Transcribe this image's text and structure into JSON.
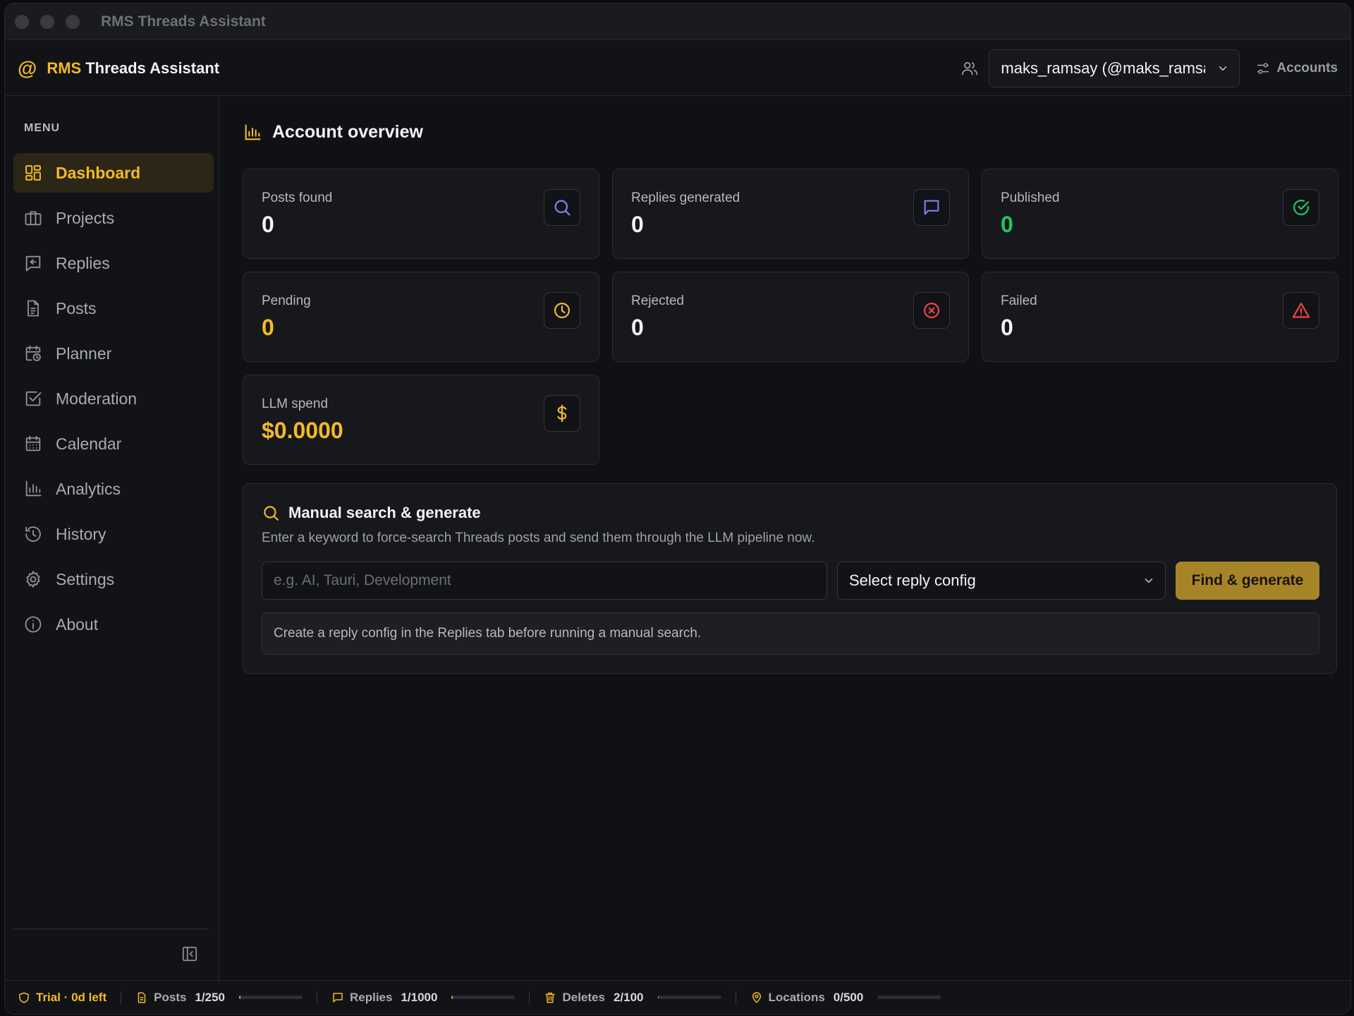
{
  "window": {
    "title": "RMS Threads Assistant"
  },
  "brand": {
    "prefix": "RMS",
    "name": "Threads Assistant"
  },
  "header": {
    "account_value": "maks_ramsay (@maks_ramsay)",
    "accounts_label": "Accounts"
  },
  "sidebar": {
    "menu_label": "MENU",
    "items": [
      {
        "label": "Dashboard",
        "icon": "dashboard-icon",
        "active": true
      },
      {
        "label": "Projects",
        "icon": "briefcase-icon"
      },
      {
        "label": "Replies",
        "icon": "reply-icon"
      },
      {
        "label": "Posts",
        "icon": "document-icon"
      },
      {
        "label": "Planner",
        "icon": "calendar-clock-icon"
      },
      {
        "label": "Moderation",
        "icon": "checkbox-icon"
      },
      {
        "label": "Calendar",
        "icon": "calendar-icon"
      },
      {
        "label": "Analytics",
        "icon": "bar-chart-icon"
      },
      {
        "label": "History",
        "icon": "history-icon"
      },
      {
        "label": "Settings",
        "icon": "gear-icon"
      },
      {
        "label": "About",
        "icon": "info-icon"
      }
    ]
  },
  "overview": {
    "title": "Account overview",
    "cards": [
      {
        "label": "Posts found",
        "value": "0",
        "color": "#f2f3f5",
        "icon": "search-icon"
      },
      {
        "label": "Replies generated",
        "value": "0",
        "color": "#f2f3f5",
        "icon": "message-icon"
      },
      {
        "label": "Published",
        "value": "0",
        "color": "#22c55e",
        "icon": "check-circle-icon"
      },
      {
        "label": "Pending",
        "value": "0",
        "color": "#f4b928",
        "icon": "clock-icon"
      },
      {
        "label": "Rejected",
        "value": "0",
        "color": "#f2f3f5",
        "icon": "x-circle-icon"
      },
      {
        "label": "Failed",
        "value": "0",
        "color": "#f2f3f5",
        "icon": "warning-icon"
      },
      {
        "label": "LLM spend",
        "value": "$0.0000",
        "color": "#f4b928",
        "icon": "dollar-icon"
      }
    ]
  },
  "manual": {
    "title": "Manual search & generate",
    "description": "Enter a keyword to force-search Threads posts and send them through the LLM pipeline now.",
    "keyword_placeholder": "e.g. AI, Tauri, Development",
    "config_value": "Select reply config",
    "button_label": "Find & generate",
    "hint": "Create a reply config in the Replies tab before running a manual search."
  },
  "status": {
    "trial": "Trial · 0d left",
    "items": [
      {
        "label": "Posts",
        "value": "1/250",
        "fraction": 0.004
      },
      {
        "label": "Replies",
        "value": "1/1000",
        "fraction": 0.001
      },
      {
        "label": "Deletes",
        "value": "2/100",
        "fraction": 0.02
      },
      {
        "label": "Locations",
        "value": "0/500",
        "fraction": 0.0
      }
    ]
  },
  "colors": {
    "accent": "#f4b928",
    "success": "#22c55e",
    "danger": "#ef4444",
    "violet": "#8b7cf6"
  }
}
